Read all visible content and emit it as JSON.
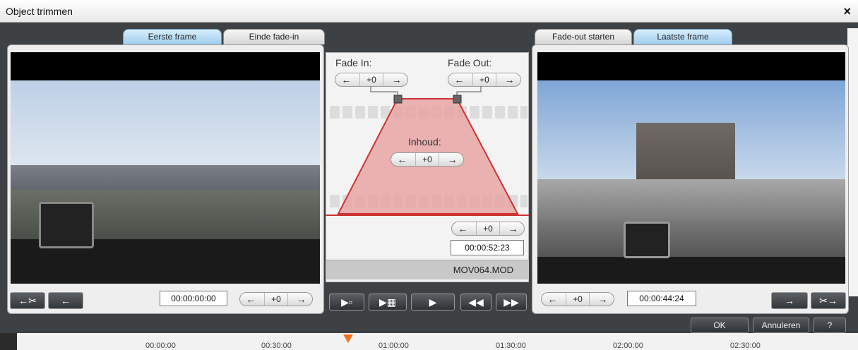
{
  "window": {
    "title": "Object trimmen",
    "close_glyph": "×"
  },
  "left_panel": {
    "tabs": [
      {
        "label": "Eerste frame",
        "active": true
      },
      {
        "label": "Einde fade-in",
        "active": false
      }
    ],
    "timecode": "00:00:00:00",
    "stepper": {
      "value": "+0"
    }
  },
  "right_panel": {
    "tabs": [
      {
        "label": "Fade-out starten",
        "active": false
      },
      {
        "label": "Laatste frame",
        "active": true
      }
    ],
    "timecode": "00:00:44:24",
    "stepper": {
      "value": "+0"
    }
  },
  "middle": {
    "fade_in": {
      "label": "Fade In:",
      "value": "+0"
    },
    "fade_out": {
      "label": "Fade Out:",
      "value": "+0"
    },
    "content": {
      "label": "Inhoud:",
      "value": "+0"
    },
    "duration_stepper": {
      "value": "+0"
    },
    "duration": "00:00:52:23",
    "filename": "MOV064.MOD"
  },
  "buttons": {
    "cut_left_glyph": "←✂",
    "left_glyph": "←",
    "right_glyph": "→",
    "cut_right_glyph": "✂→",
    "play_glyph": "▶",
    "rewind_glyph": "◀◀",
    "forward_glyph": "▶▶",
    "ok": "OK",
    "cancel": "Annuleren",
    "help": "?"
  },
  "stepper_arrows": {
    "left": "←",
    "right": "→"
  },
  "timeline": {
    "ticks": [
      "00:00:00",
      "00:30:00",
      "01:00:00",
      "01:30:00",
      "02:00:00",
      "02:30:00"
    ],
    "playhead_color": "#f07020"
  },
  "colors": {
    "fade_fill": "#e8a4a4",
    "fade_stroke": "#cc3333",
    "tab_active": "#9fcdef"
  }
}
